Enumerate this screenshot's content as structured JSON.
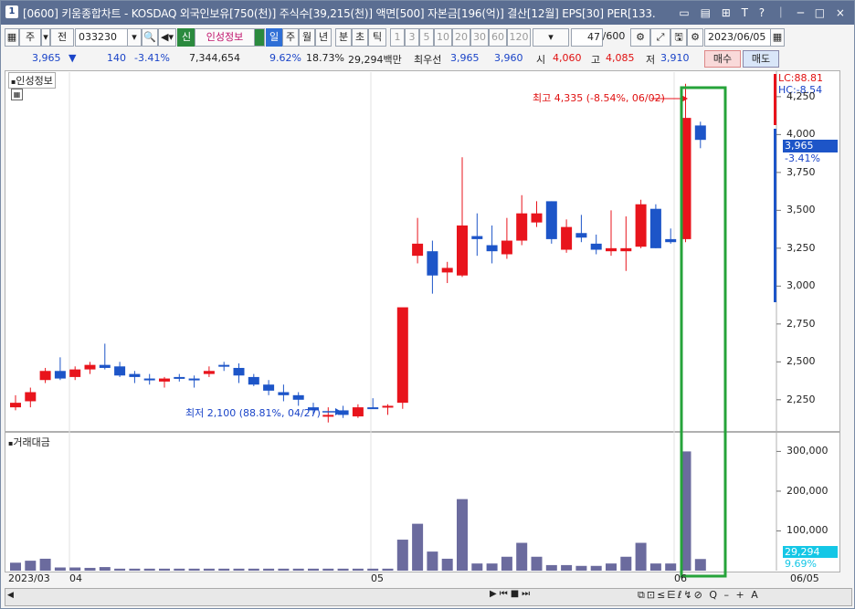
{
  "window": {
    "num": "1",
    "title": "[0600] 키움종합차트 - KOSDAQ 외국인보유[750(천)] 주식수[39,215(천)] 액면[500] 자본금[196(억)] 결산[12월] EPS[30] PER[133.",
    "controls": "▭ ▤ ⊞ T ? ｜ ─ □ ×"
  },
  "toolbar": {
    "b_ju": "주",
    "b_jeon": "전",
    "code": "033230",
    "b_sin": "신",
    "stock_name": "인성정보",
    "periods": [
      "일",
      "주",
      "월",
      "년",
      "분",
      "초",
      "틱"
    ],
    "minutes": [
      "1",
      "3",
      "5",
      "10",
      "20",
      "30",
      "60",
      "120"
    ],
    "page": "47",
    "page_total": "/600",
    "date": "2023/06/05"
  },
  "quote": {
    "price": "3,965",
    "arrow": "▼",
    "change": "140",
    "rate": "-3.41%",
    "volume": "7,344,654",
    "vol_ratio": "9.62%",
    "turnover": "18.73%",
    "amount": "29,294백만",
    "bid_label": "최우선",
    "ask": "3,965",
    "bid": "3,960",
    "open_label": "시",
    "open": "4,060",
    "high_label": "고",
    "high": "4,085",
    "low_label": "저",
    "low": "3,910",
    "buy": "매수",
    "sell": "매도"
  },
  "price_pane": {
    "label": "인성정보",
    "lc": "LC:88.81",
    "hc": "HC:-8.54",
    "current": "3,965",
    "current_rate": "-3.41%",
    "high_annot": "최고 4,335 (-8.54%, 06/02)",
    "low_annot": "최저 2,100 (88.81%, 04/27)",
    "y_ticks": [
      "4,250",
      "4,000",
      "3,750",
      "3,500",
      "3,250",
      "3,000",
      "2,750",
      "2,500",
      "2,250"
    ]
  },
  "volume_pane": {
    "label": "거래대금",
    "y_ticks": [
      "300,000",
      "200,000",
      "100,000"
    ],
    "current": "29,294",
    "current_rate": "9.69%"
  },
  "x_axis": {
    "labels": [
      "2023/03",
      "04",
      "05",
      "06"
    ],
    "end": "06/05"
  },
  "colors": {
    "up": "#e8141c",
    "down": "#1d55c8",
    "volume": "#6b6b9e",
    "highlight": "#26a33a"
  },
  "chart_data": {
    "type": "candlestick",
    "price_range": [
      2050,
      4400
    ],
    "volume_range": [
      0,
      340000
    ],
    "candles": [
      {
        "o": 2200,
        "h": 2280,
        "l": 2180,
        "c": 2230
      },
      {
        "o": 2240,
        "h": 2330,
        "l": 2200,
        "c": 2300
      },
      {
        "o": 2380,
        "h": 2460,
        "l": 2360,
        "c": 2440
      },
      {
        "o": 2440,
        "h": 2530,
        "l": 2380,
        "c": 2390
      },
      {
        "o": 2400,
        "h": 2470,
        "l": 2380,
        "c": 2450
      },
      {
        "o": 2450,
        "h": 2500,
        "l": 2420,
        "c": 2480
      },
      {
        "o": 2480,
        "h": 2620,
        "l": 2450,
        "c": 2460
      },
      {
        "o": 2470,
        "h": 2500,
        "l": 2400,
        "c": 2410
      },
      {
        "o": 2420,
        "h": 2440,
        "l": 2360,
        "c": 2400
      },
      {
        "o": 2390,
        "h": 2420,
        "l": 2350,
        "c": 2380
      },
      {
        "o": 2370,
        "h": 2400,
        "l": 2330,
        "c": 2390
      },
      {
        "o": 2400,
        "h": 2420,
        "l": 2370,
        "c": 2390
      },
      {
        "o": 2390,
        "h": 2410,
        "l": 2330,
        "c": 2380
      },
      {
        "o": 2420,
        "h": 2470,
        "l": 2400,
        "c": 2440
      },
      {
        "o": 2480,
        "h": 2500,
        "l": 2440,
        "c": 2470
      },
      {
        "o": 2460,
        "h": 2490,
        "l": 2360,
        "c": 2410
      },
      {
        "o": 2400,
        "h": 2420,
        "l": 2340,
        "c": 2350
      },
      {
        "o": 2350,
        "h": 2380,
        "l": 2280,
        "c": 2310
      },
      {
        "o": 2300,
        "h": 2350,
        "l": 2240,
        "c": 2280
      },
      {
        "o": 2280,
        "h": 2300,
        "l": 2210,
        "c": 2250
      },
      {
        "o": 2200,
        "h": 2230,
        "l": 2150,
        "c": 2180
      },
      {
        "o": 2140,
        "h": 2200,
        "l": 2100,
        "c": 2150
      },
      {
        "o": 2180,
        "h": 2210,
        "l": 2130,
        "c": 2150
      },
      {
        "o": 2140,
        "h": 2220,
        "l": 2130,
        "c": 2200
      },
      {
        "o": 2200,
        "h": 2260,
        "l": 2190,
        "c": 2190
      },
      {
        "o": 2200,
        "h": 2220,
        "l": 2150,
        "c": 2210
      },
      {
        "o": 2230,
        "h": 2300,
        "l": 2190,
        "c": 2860
      },
      {
        "o": 3200,
        "h": 3450,
        "l": 3150,
        "c": 3280
      },
      {
        "o": 3230,
        "h": 3300,
        "l": 2950,
        "c": 3070
      },
      {
        "o": 3090,
        "h": 3160,
        "l": 3020,
        "c": 3120
      },
      {
        "o": 3070,
        "h": 3850,
        "l": 3060,
        "c": 3400
      },
      {
        "o": 3330,
        "h": 3480,
        "l": 3200,
        "c": 3310
      },
      {
        "o": 3270,
        "h": 3400,
        "l": 3150,
        "c": 3230
      },
      {
        "o": 3210,
        "h": 3450,
        "l": 3180,
        "c": 3300
      },
      {
        "o": 3300,
        "h": 3600,
        "l": 3270,
        "c": 3480
      },
      {
        "o": 3420,
        "h": 3560,
        "l": 3390,
        "c": 3480
      },
      {
        "o": 3560,
        "h": 3560,
        "l": 3280,
        "c": 3310
      },
      {
        "o": 3240,
        "h": 3440,
        "l": 3220,
        "c": 3390
      },
      {
        "o": 3350,
        "h": 3470,
        "l": 3290,
        "c": 3320
      },
      {
        "o": 3280,
        "h": 3340,
        "l": 3210,
        "c": 3240
      },
      {
        "o": 3230,
        "h": 3500,
        "l": 3200,
        "c": 3250
      },
      {
        "o": 3230,
        "h": 3460,
        "l": 3100,
        "c": 3250
      },
      {
        "o": 3260,
        "h": 3570,
        "l": 3250,
        "c": 3540
      },
      {
        "o": 3510,
        "h": 3540,
        "l": 3250,
        "c": 3250
      },
      {
        "o": 3310,
        "h": 3380,
        "l": 3280,
        "c": 3290
      },
      {
        "o": 3310,
        "h": 4335,
        "l": 3290,
        "c": 4110
      },
      {
        "o": 4060,
        "h": 4085,
        "l": 3910,
        "c": 3965
      }
    ],
    "volumes": [
      20000,
      25000,
      30000,
      8000,
      8000,
      7000,
      9000,
      5000,
      5000,
      5000,
      5000,
      5000,
      5000,
      5000,
      5000,
      5000,
      5000,
      5000,
      5000,
      5000,
      5000,
      5000,
      5000,
      5000,
      5000,
      5000,
      78000,
      118000,
      48000,
      30000,
      180000,
      18000,
      18000,
      35000,
      70000,
      35000,
      14000,
      14000,
      12000,
      12000,
      18000,
      35000,
      70000,
      18000,
      18000,
      300000,
      29294
    ]
  }
}
